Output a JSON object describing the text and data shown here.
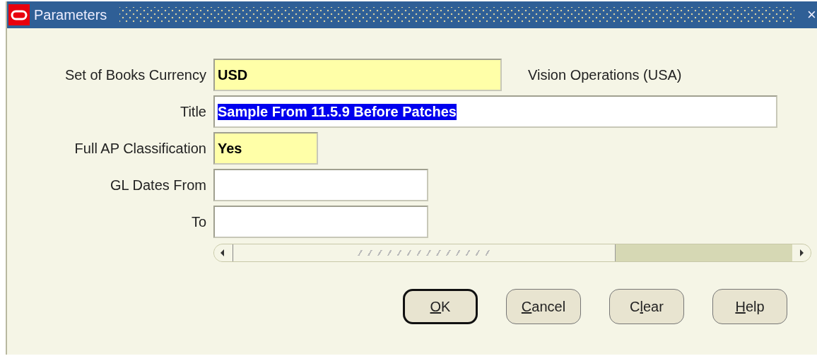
{
  "window": {
    "title": "Parameters",
    "close": "×"
  },
  "fields": [
    {
      "label": "Set of Books Currency",
      "value": "USD",
      "required": true,
      "note": "Vision Operations (USA)"
    },
    {
      "label": "Title",
      "value": "Sample From 11.5.9 Before Patches",
      "required": false,
      "selected": true
    },
    {
      "label": "Full AP Classification",
      "value": "Yes",
      "required": true
    },
    {
      "label": "GL Dates From",
      "required": false
    },
    {
      "label": "To",
      "required": false
    }
  ],
  "buttons": [
    {
      "key": "O",
      "after": "K",
      "default": true
    },
    {
      "key": "C",
      "after": "ancel",
      "default": false
    },
    {
      "before": "C",
      "key": "l",
      "after": "ear",
      "default": false
    },
    {
      "key": "H",
      "after": "elp",
      "default": false
    }
  ]
}
